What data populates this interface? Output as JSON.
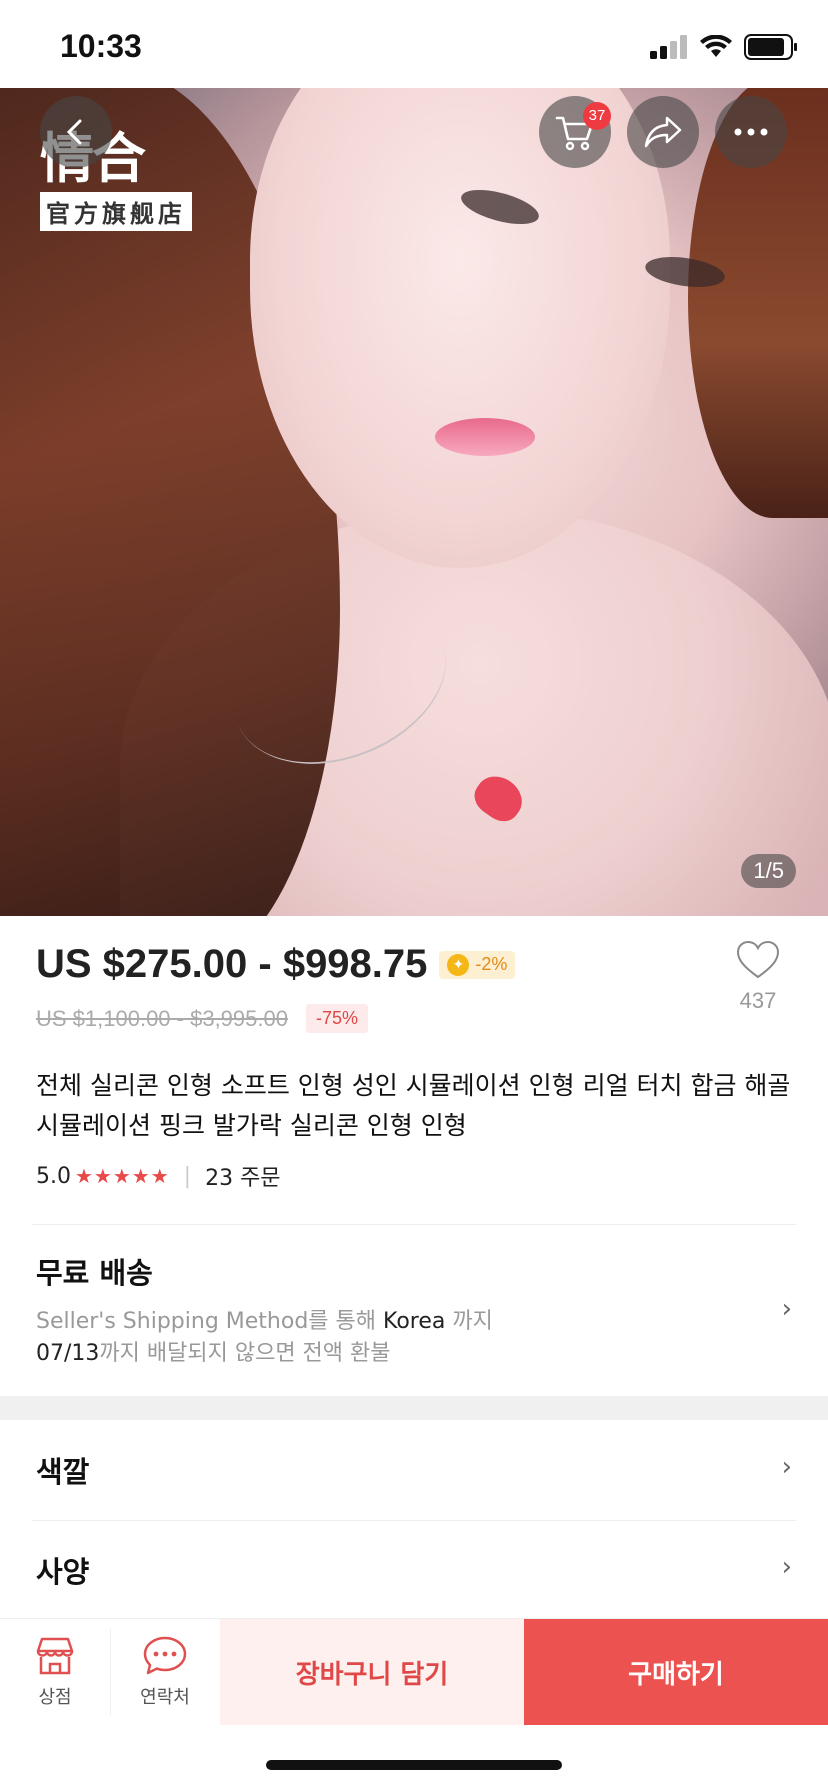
{
  "status_bar": {
    "time": "10:33"
  },
  "hero": {
    "logo_text": "情合",
    "logo_sub": "官方旗舰店",
    "cart_badge": "37",
    "image_counter": "1/5"
  },
  "product": {
    "price": "US $275.00 - $998.75",
    "coin_discount": "-2%",
    "original_price": "US $1,100.00 - $3,995.00",
    "discount": "-75%",
    "wishlist_count": "437",
    "title": "전체 실리콘 인형 소프트 인형 성인 시뮬레이션 인형 리얼 터치 합금 해골 시뮬레이션 핑크 발가락 실리콘 인형 인형",
    "rating": "5.0",
    "stars": "★★★★★",
    "orders": "23 주문"
  },
  "shipping": {
    "title": "무료 배송",
    "method": "Seller's Shipping Method를 통해 ",
    "destination": "Korea",
    "until": " 까지",
    "refund_date": "07/13",
    "refund_text": "까지 배달되지 않으면 전액 환불"
  },
  "options": {
    "color": "색깔",
    "spec": "사양"
  },
  "bottom_bar": {
    "store_label": "상점",
    "contact_label": "연락처",
    "add_to_cart": "장바구니 담기",
    "buy_now": "구매하기"
  },
  "colors": {
    "accent": "#ec5350",
    "star": "#e84a4a",
    "coin": "#f4b715"
  }
}
